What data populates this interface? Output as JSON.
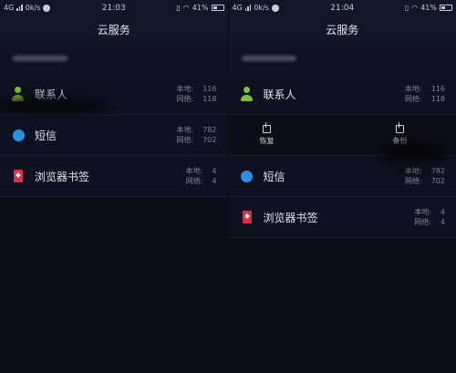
{
  "left": {
    "status": {
      "network": "4G",
      "speed": "0k/s",
      "time": "21:03",
      "battery": "41%"
    },
    "title": "云服务",
    "items": [
      {
        "label": "联系人",
        "local_key": "本地:",
        "local_val": "116",
        "net_key": "网络:",
        "net_val": "118",
        "icon": "person-icon"
      },
      {
        "label": "短信",
        "local_key": "本地:",
        "local_val": "782",
        "net_key": "网络:",
        "net_val": "702",
        "icon": "message-bubble-icon"
      },
      {
        "label": "浏览器书签",
        "local_key": "本地:",
        "local_val": "4",
        "net_key": "网络:",
        "net_val": "4",
        "icon": "bookmark-icon"
      }
    ]
  },
  "right": {
    "status": {
      "network": "4G",
      "speed": "0k/s",
      "time": "21:04",
      "battery": "41%"
    },
    "title": "云服务",
    "items": [
      {
        "label": "联系人",
        "local_key": "本地:",
        "local_val": "116",
        "net_key": "网络:",
        "net_val": "118",
        "icon": "person-icon"
      },
      {
        "label": "短信",
        "local_key": "本地:",
        "local_val": "782",
        "net_key": "网络:",
        "net_val": "702",
        "icon": "message-bubble-icon"
      },
      {
        "label": "浏览器书签",
        "local_key": "本地:",
        "local_val": "4",
        "net_key": "网络:",
        "net_val": "4",
        "icon": "bookmark-icon"
      }
    ],
    "actions": {
      "restore": "恢复",
      "backup": "备份"
    }
  },
  "colors": {
    "background": "#0b0e17",
    "header": "#121728",
    "green": "#7fc041",
    "blue": "#2f8de4",
    "red": "#d8324a"
  }
}
